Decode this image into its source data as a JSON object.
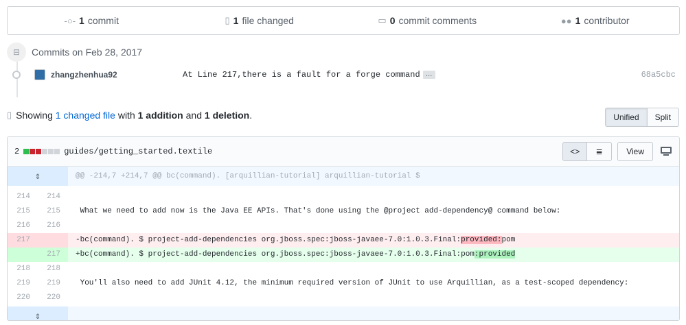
{
  "summary": {
    "commits_count": "1",
    "commits_label": "commit",
    "files_count": "1",
    "files_label": "file changed",
    "comments_count": "0",
    "comments_label": "commit comments",
    "contributors_count": "1",
    "contributors_label": "contributor"
  },
  "commits": {
    "date_label": "Commits on Feb 28, 2017",
    "author": "zhangzhenhua92",
    "message": "At Line 217,there is a fault for a forge command",
    "ellipsis": "…",
    "sha": "68a5cbc"
  },
  "toc": {
    "prefix": "Showing ",
    "changed_link": "1 changed file",
    "mid": " with ",
    "additions": "1 addition",
    "and": " and ",
    "deletions": "1 deletion",
    "end": ".",
    "unified": "Unified",
    "split": "Split"
  },
  "file": {
    "diffstat": "2",
    "path": "guides/getting_started.textile",
    "view": "View",
    "diffstat_colors": [
      "#2cbe4e",
      "#cb2431",
      "#cb2431",
      "#d1d5da",
      "#d1d5da",
      "#d1d5da"
    ],
    "hunk_header": "@@ -214,7 +214,7 @@ bc(command). [arquillian-tutorial] arquillian-tutorial $",
    "lines": [
      {
        "old": "214",
        "new": "214",
        "text": ""
      },
      {
        "old": "215",
        "new": "215",
        "text": " What we need to add now is the Java EE APIs. That's done using the @project add-dependency@ command below:"
      },
      {
        "old": "216",
        "new": "216",
        "text": ""
      },
      {
        "old": "217",
        "new": "",
        "pre": "-bc(command). $ project-add-dependencies org.jboss.spec:jboss-javaee-7.0:1.0.3.Final:",
        "hl": "provided:",
        "post": "pom"
      },
      {
        "old": "",
        "new": "217",
        "pre": "+bc(command). $ project-add-dependencies org.jboss.spec:jboss-javaee-7.0:1.0.3.Final:pom",
        "hl": ":provided",
        "post": ""
      },
      {
        "old": "218",
        "new": "218",
        "text": ""
      },
      {
        "old": "219",
        "new": "219",
        "text": " You'll also need to add JUnit 4.12, the minimum required version of JUnit to use Arquillian, as a test-scoped dependency:"
      },
      {
        "old": "220",
        "new": "220",
        "text": ""
      }
    ]
  },
  "icons": {
    "commit": "commit-icon",
    "file": "file-diff-icon",
    "comment": "comment-icon",
    "people": "people-icon",
    "expand": "unfold-icon",
    "code": "code-icon",
    "file_text": "file-text-icon",
    "desktop": "desktop-icon"
  }
}
